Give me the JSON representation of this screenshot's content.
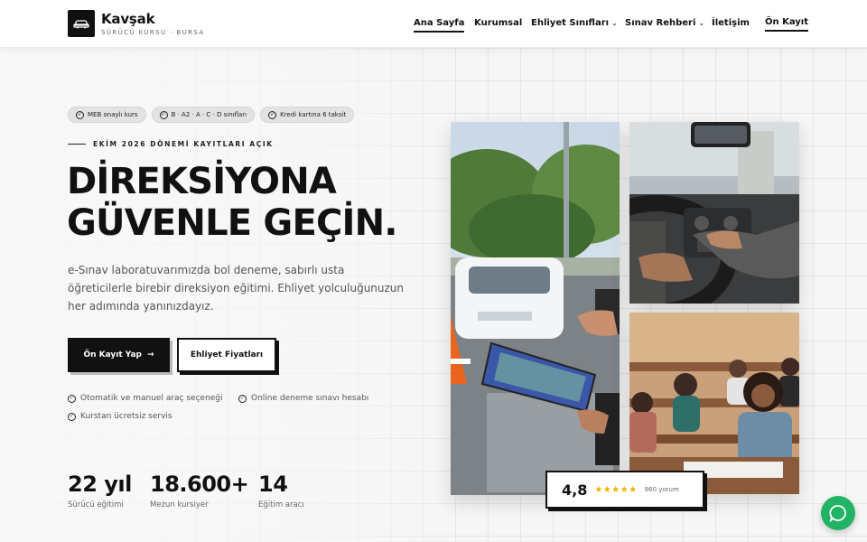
{
  "brand": {
    "name": "Kavşak",
    "subtitle": "SÜRÜCÜ KURSU · BURSA"
  },
  "nav": {
    "items": [
      {
        "label": "Ana Sayfa",
        "active": true
      },
      {
        "label": "Kurumsal"
      },
      {
        "label": "Ehliyet Sınıfları",
        "dropdown": true
      },
      {
        "label": "Sınav Rehberi",
        "dropdown": true
      },
      {
        "label": "İletişim"
      }
    ],
    "cta": "Ön Kayıt"
  },
  "hero": {
    "badges": [
      "MEB onaylı kurs",
      "B · A2 · A · C · D sınıfları",
      "Kredi kartına 6 taksit"
    ],
    "eyebrow": "EKİM 2026 DÖNEMİ KAYITLARI AÇIK",
    "title_line1": "DİREKSİYONA",
    "title_line2": "GÜVENLE GEÇİN.",
    "lead": "e-Sınav laboratuvarımızda bol deneme, sabırlı usta öğreticilerle birebir direksiyon eğitimi. Ehliyet yolculuğunuzun her adımında yanınızdayız.",
    "primary_button": "Ön Kayıt Yap",
    "secondary_button": "Ehliyet Fiyatları",
    "features": [
      "Otomatik ve manuel araç seçeneği",
      "Online deneme sınavı hesabı",
      "Kurstan ücretsiz servis"
    ],
    "stats": [
      {
        "value": "22 yıl",
        "label": "Sürücü eğitimi"
      },
      {
        "value": "18.600+",
        "label": "Mezun kursiyer"
      },
      {
        "value": "14",
        "label": "Eğitim aracı"
      }
    ]
  },
  "rating": {
    "value": "4,8",
    "stars": "★★★★★",
    "count": "960 yorum"
  },
  "colors": {
    "primary": "#111111",
    "accent_star": "#f0b400",
    "whatsapp": "#22b364"
  }
}
